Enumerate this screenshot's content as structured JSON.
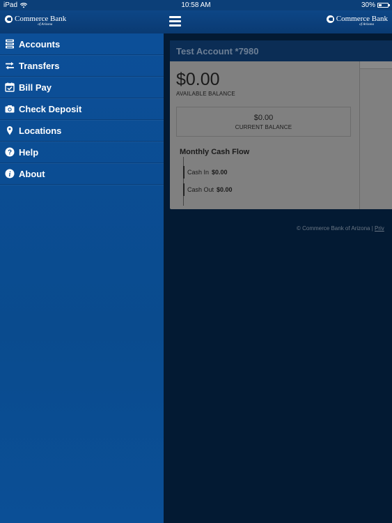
{
  "status_bar": {
    "device": "iPad",
    "time": "10:58 AM",
    "battery": "30%"
  },
  "navbar": {
    "brand_name": "Commerce Bank",
    "brand_sub": "of Arizona"
  },
  "sidebar": {
    "items": [
      {
        "label": "Accounts",
        "icon": "accounts-icon"
      },
      {
        "label": "Transfers",
        "icon": "transfer-arrows-icon"
      },
      {
        "label": "Bill Pay",
        "icon": "calendar-check-icon"
      },
      {
        "label": "Check Deposit",
        "icon": "camera-icon"
      },
      {
        "label": "Locations",
        "icon": "map-pin-icon"
      },
      {
        "label": "Help",
        "icon": "question-icon"
      },
      {
        "label": "About",
        "icon": "info-icon"
      }
    ]
  },
  "account": {
    "title": "Test Account *7980",
    "available_balance": "$0.00",
    "available_label": "AVAILABLE BALANCE",
    "current_balance": "$0.00",
    "current_label": "CURRENT BALANCE",
    "cash_flow_title": "Monthly Cash Flow",
    "cash_in_label": "Cash In",
    "cash_in_value": "$0.00",
    "cash_out_label": "Cash Out",
    "cash_out_value": "$0.00"
  },
  "footer": {
    "text": "© Commerce Bank of Arizona | ",
    "link": "Priv"
  },
  "colors": {
    "sidebar_bg": "#0b4f96",
    "navbar_bg": "#0b3f7a",
    "overlay_bg": "#031a33"
  }
}
